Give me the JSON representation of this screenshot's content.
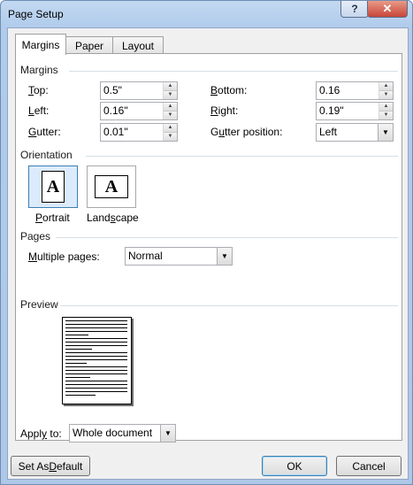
{
  "window": {
    "title": "Page Setup"
  },
  "titlebar": {
    "help_label": "?",
    "close_label": "✕"
  },
  "tabs": [
    {
      "label": "Margins",
      "active": true
    },
    {
      "label": "Paper",
      "active": false
    },
    {
      "label": "Layout",
      "active": false
    }
  ],
  "margins": {
    "section_label": "Margins",
    "top": {
      "mnemonic": "T",
      "rest": "op:",
      "value": "0.5\""
    },
    "bottom": {
      "mnemonic": "B",
      "rest": "ottom:",
      "value": "0.16"
    },
    "left": {
      "mnemonic": "L",
      "rest": "eft:",
      "value": "0.16\""
    },
    "right": {
      "mnemonic": "R",
      "rest": "ight:",
      "value": "0.19\""
    },
    "gutter": {
      "mnemonic": "G",
      "rest": "utter:",
      "value": "0.01\""
    },
    "gutter_position": {
      "mnemonic": "u",
      "pre": "G",
      "rest": "tter position:",
      "value": "Left"
    }
  },
  "orientation": {
    "section_label": "Orientation",
    "icon_letter": "A",
    "portrait": {
      "mnemonic": "P",
      "rest": "ortrait",
      "selected": true
    },
    "landscape": {
      "pre": "Land",
      "mnemonic": "s",
      "rest": "cape",
      "selected": false
    }
  },
  "pages": {
    "section_label": "Pages",
    "multiple_pages": {
      "mnemonic": "M",
      "rest": "ultiple pages:",
      "value": "Normal"
    }
  },
  "preview": {
    "section_label": "Preview"
  },
  "apply_to": {
    "pre": "Appl",
    "mnemonic": "y",
    "rest": " to:",
    "value": "Whole document"
  },
  "buttons": {
    "set_default": {
      "pre": "Set As ",
      "mnemonic": "D",
      "rest": "efault"
    },
    "ok": "OK",
    "cancel": "Cancel"
  },
  "icons": {
    "spin_up": "▲",
    "spin_down": "▼",
    "dropdown": "▼"
  }
}
